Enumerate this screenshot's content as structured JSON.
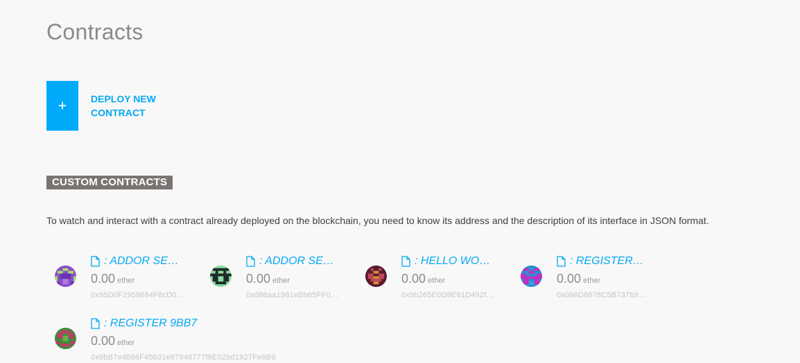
{
  "page": {
    "title": "Contracts"
  },
  "deploy": {
    "icon": "plus-icon",
    "icon_glyph": "+",
    "label_line1": "DEPLOY NEW",
    "label_line2": "CONTRACT",
    "accent_color": "#00aafa"
  },
  "custom_contracts": {
    "heading": "CUSTOM CONTRACTS",
    "description": "To watch and interact with a contract already deployed on the blockchain, you need to know its address and the description of its interface in JSON format.",
    "items": [
      {
        "name": ": ADDOR SE…",
        "balance": "0.00",
        "unit": "ether",
        "address": "0x95D0F2959684F8cD0…",
        "icon": "file-icon"
      },
      {
        "name": ": ADDOR SE…",
        "balance": "0.00",
        "unit": "ether",
        "address": "0xd86aa1961eBb65FF0…",
        "icon": "file-icon"
      },
      {
        "name": ": HELLO WO…",
        "balance": "0.00",
        "unit": "ether",
        "address": "0x9b265E0D9E61D492f…",
        "icon": "file-icon"
      },
      {
        "name": ": REGISTER…",
        "balance": "0.00",
        "unit": "ether",
        "address": "0x066D8678C5B737b9…",
        "icon": "file-icon"
      },
      {
        "name": ": REGISTER 9BB7",
        "balance": "0.00",
        "unit": "ether",
        "address": "0x9bB7e4886F45b31e87946777f9E02bd1927Fe6B9",
        "icon": "file-icon"
      }
    ]
  }
}
